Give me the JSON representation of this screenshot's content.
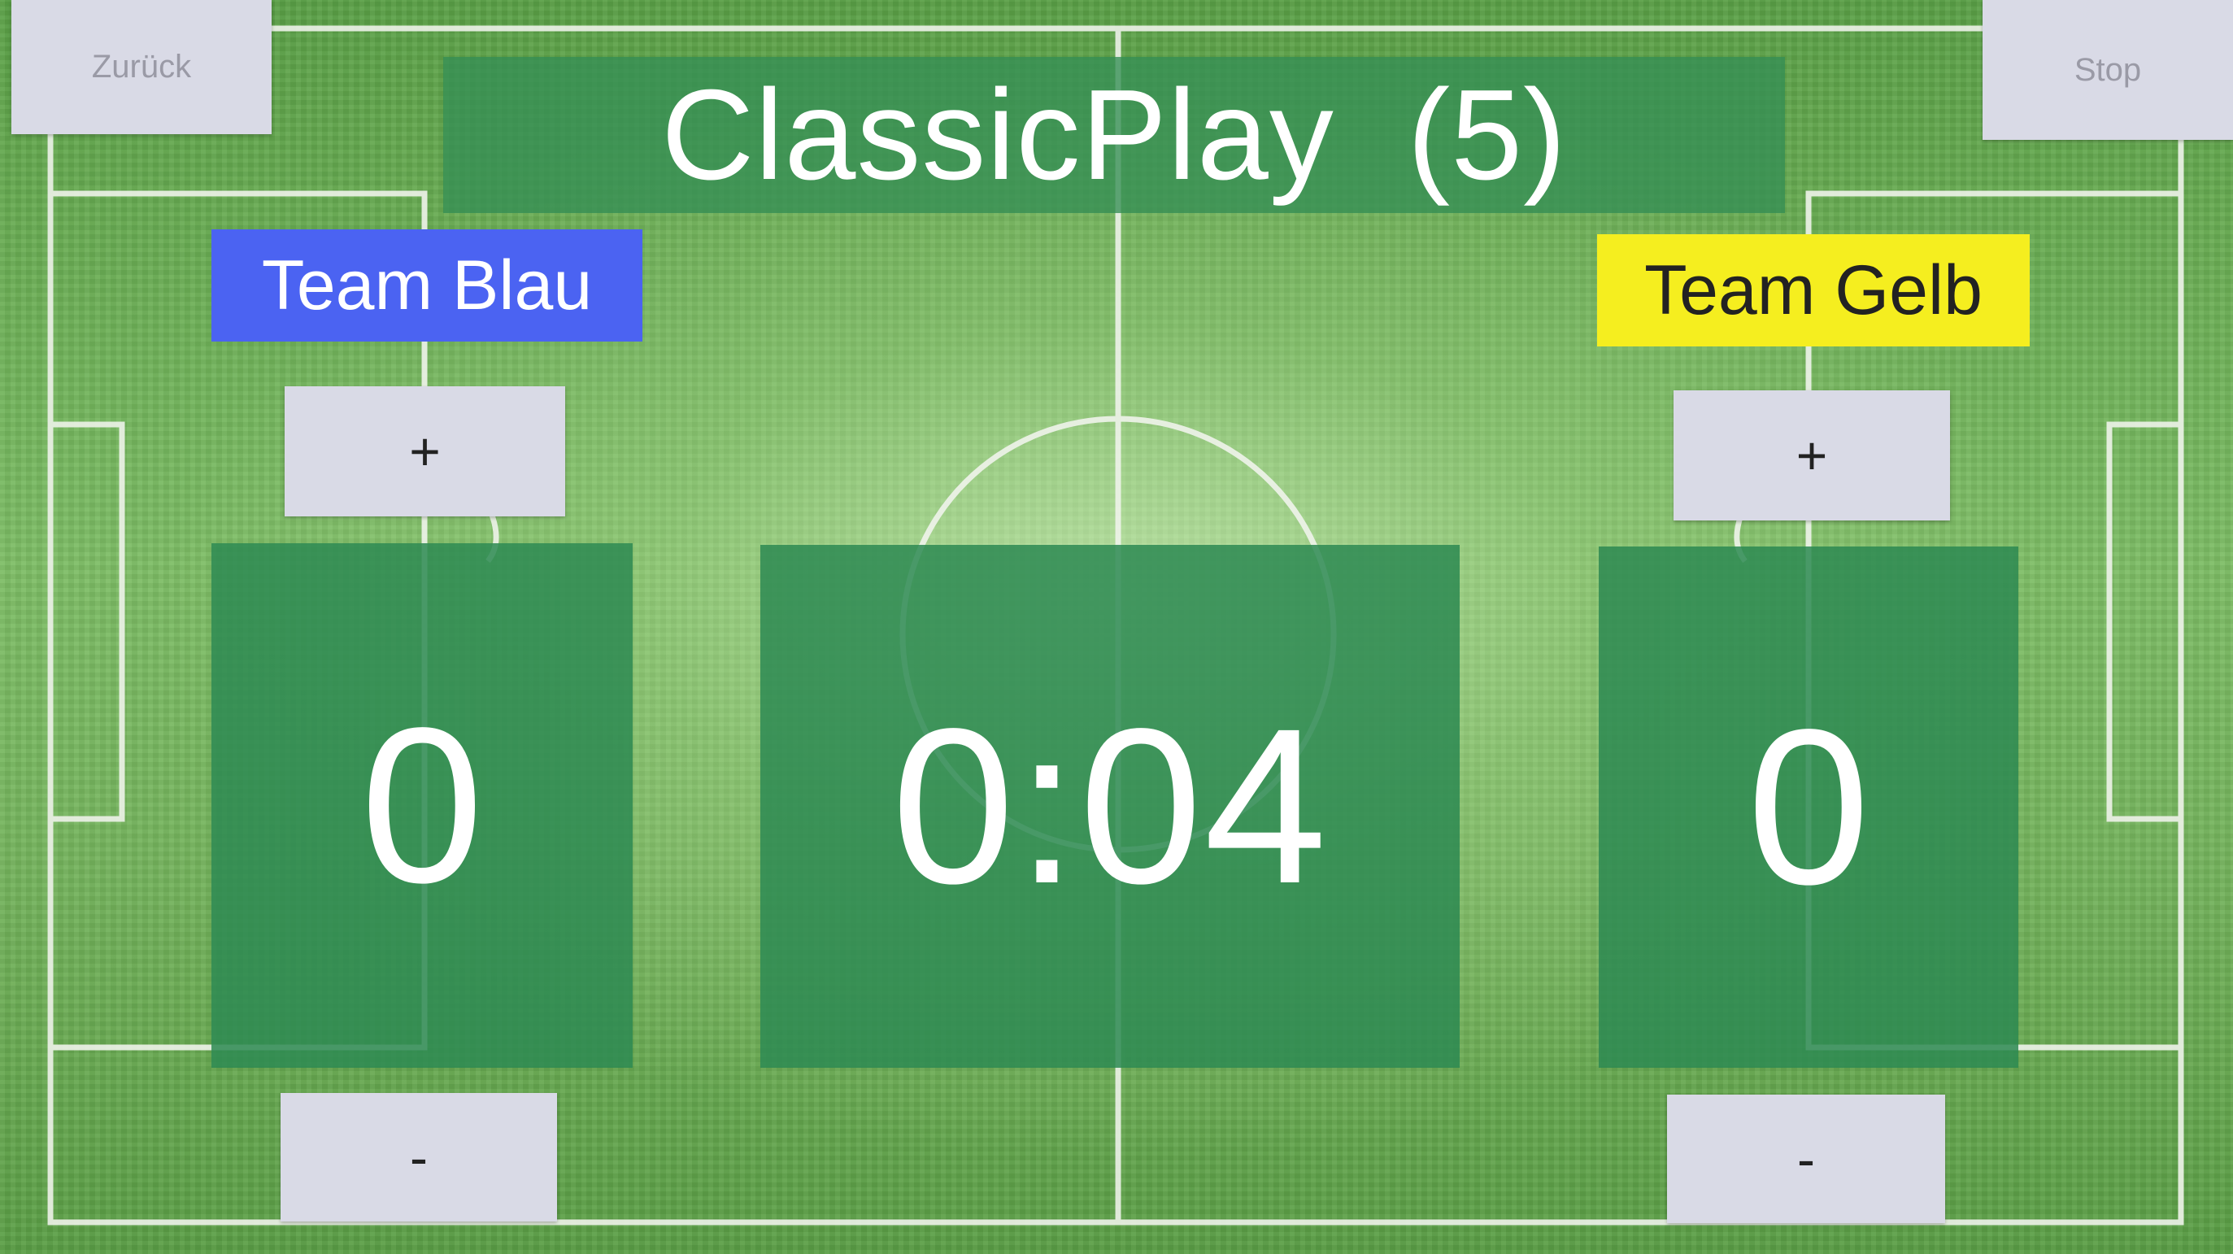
{
  "nav": {
    "back_label": "Zurück",
    "stop_label": "Stop"
  },
  "header": {
    "title": "ClassicPlay  (5)"
  },
  "teams": {
    "left": {
      "name": "Team Blau",
      "color": "#4b63f2",
      "score": "0",
      "plus_label": "+",
      "minus_label": "-"
    },
    "right": {
      "name": "Team Gelb",
      "color": "#f5ee1f",
      "score": "0",
      "plus_label": "+",
      "minus_label": "-"
    }
  },
  "timer": {
    "value": "0:04"
  },
  "colors": {
    "panel_green": "#2d8a52",
    "button_gray": "#d9dae6",
    "field_green": "#6cb052"
  }
}
